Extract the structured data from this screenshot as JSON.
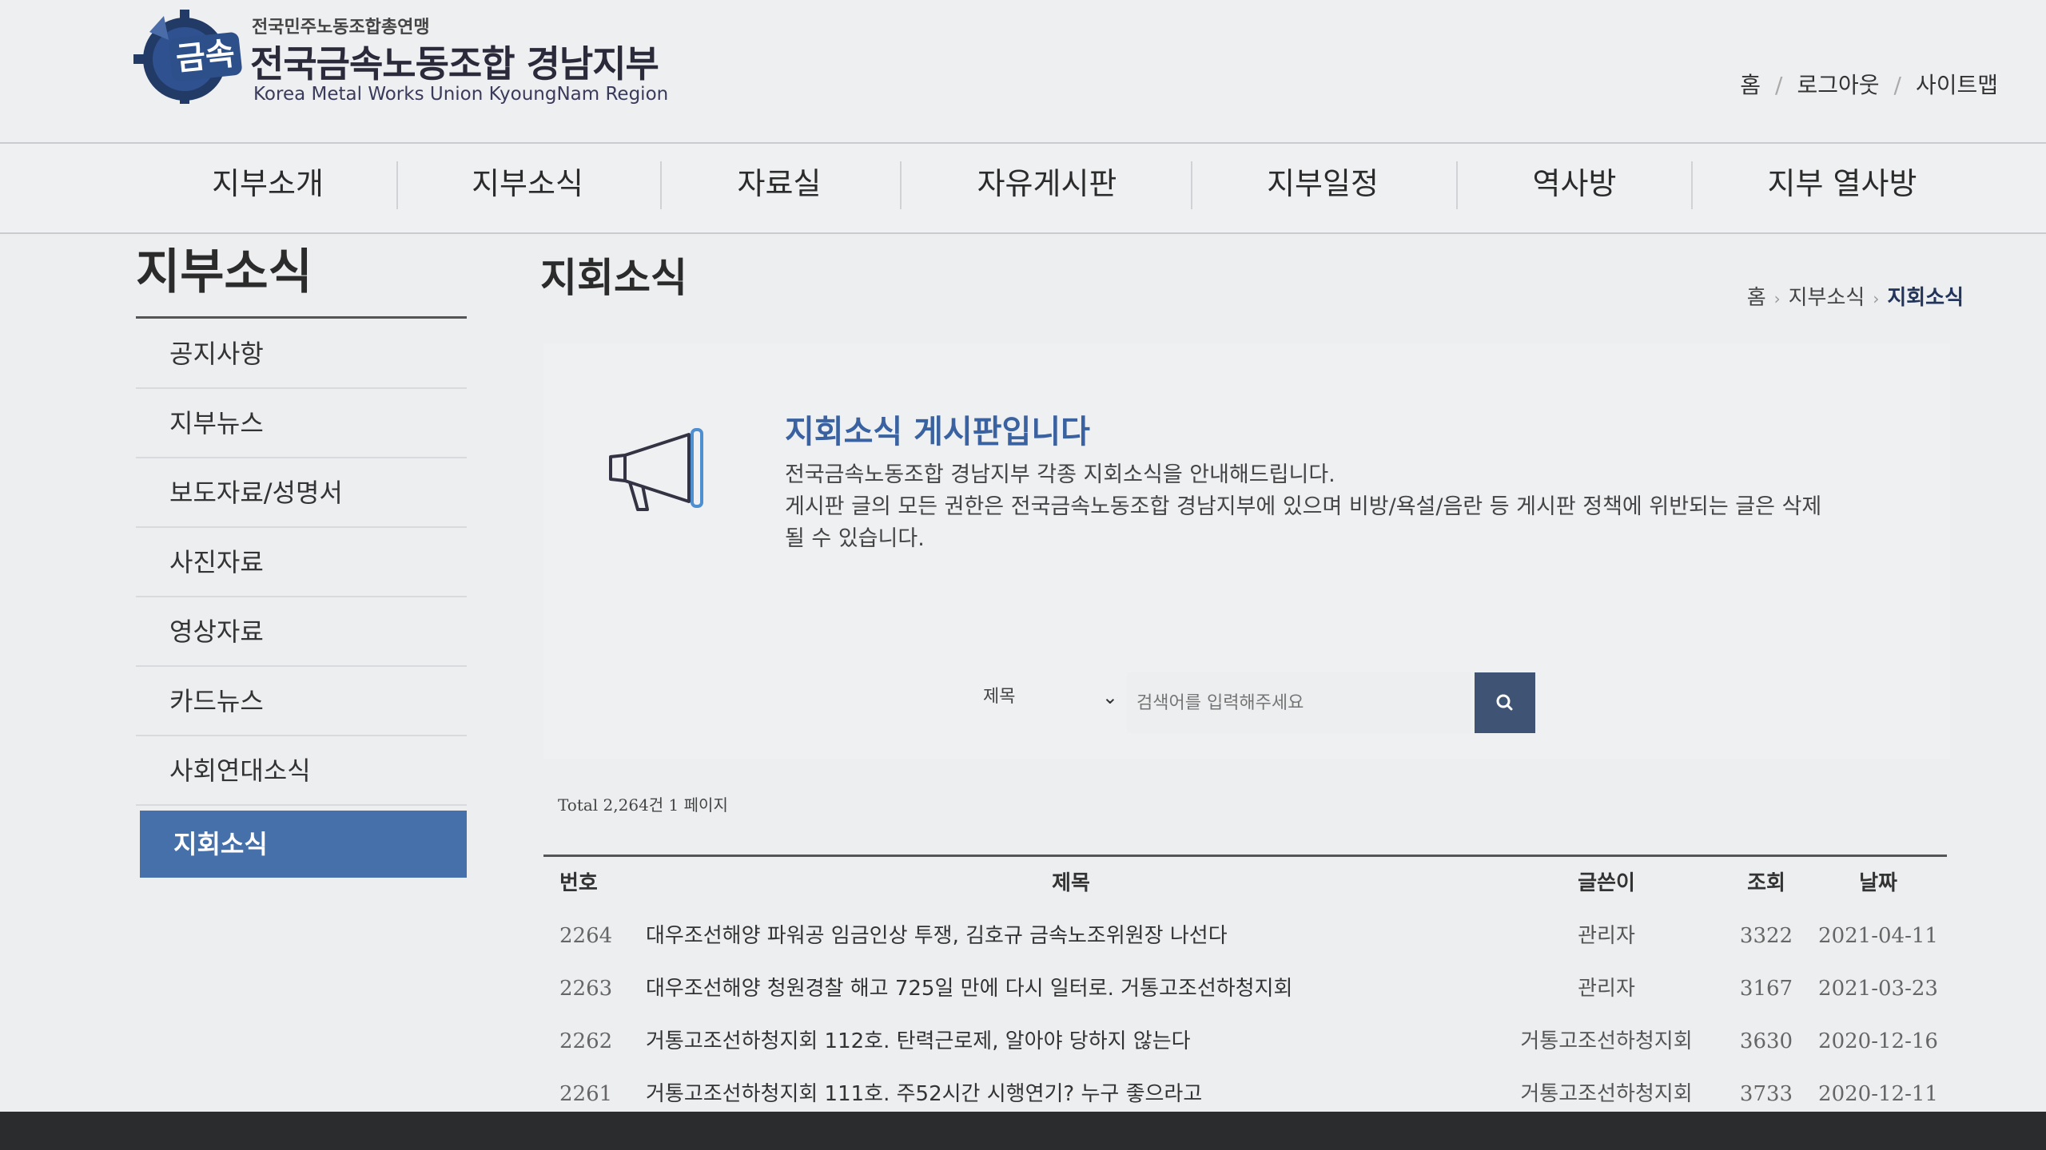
{
  "header": {
    "federation": "전국민주노동조합총연맹",
    "org_name": "전국금속노동조합 경남지부",
    "org_name_en": "Korea Metal Works Union KyoungNam Region",
    "logo_badge": "금속",
    "util_links": [
      "홈",
      "로그아웃",
      "사이트맵"
    ]
  },
  "gnb": [
    "지부소개",
    "지부소식",
    "자료실",
    "자유게시판",
    "지부일정",
    "역사방",
    "지부 열사방"
  ],
  "sidebar": {
    "title": "지부소식",
    "items": [
      "공지사항",
      "지부뉴스",
      "보도자료/성명서",
      "사진자료",
      "영상자료",
      "카드뉴스",
      "사회연대소식",
      "지회소식"
    ],
    "active": "지회소식"
  },
  "page": {
    "title": "지회소식",
    "breadcrumb": [
      "홈",
      "지부소식",
      "지회소식"
    ]
  },
  "info": {
    "icon": "megaphone-icon",
    "title": "지회소식 게시판입니다",
    "line1": "전국금속노동조합 경남지부 각종 지회소식을 안내해드립니다.",
    "line2": "게시판 글의 모든 권한은 전국금속노동조합 경남지부에 있으며 비방/욕설/음란 등 게시판 정책에 위반되는 글은 삭제",
    "line3": "될 수 있습니다."
  },
  "search": {
    "field_selected": "제목",
    "placeholder": "검색어를 입력해주세요",
    "button_icon": "search-icon"
  },
  "total_text": "Total 2,264건 1 페이지",
  "board": {
    "headers": {
      "num": "번호",
      "title": "제목",
      "writer": "글쓴이",
      "hits": "조회",
      "date": "날짜"
    },
    "rows": [
      {
        "num": "2264",
        "title": "대우조선해양 파워공 임금인상 투쟁, 김호규 금속노조위원장 나선다",
        "writer": "관리자",
        "hits": "3322",
        "date": "2021-04-11"
      },
      {
        "num": "2263",
        "title": "대우조선해양 청원경찰 해고 725일 만에 다시 일터로. 거통고조선하청지회",
        "writer": "관리자",
        "hits": "3167",
        "date": "2021-03-23"
      },
      {
        "num": "2262",
        "title": "거통고조선하청지회 112호. 탄력근로제, 알아야 당하지 않는다",
        "writer": "거통고조선하청지회",
        "hits": "3630",
        "date": "2020-12-16"
      },
      {
        "num": "2261",
        "title": "거통고조선하청지회 111호. 주52시간 시행연기? 누구 좋으라고",
        "writer": "거통고조선하청지회",
        "hits": "3733",
        "date": "2020-12-11"
      }
    ]
  },
  "colors": {
    "accent": "#4670aa",
    "search_button": "#3f5475",
    "info_title": "#3a62a0"
  }
}
